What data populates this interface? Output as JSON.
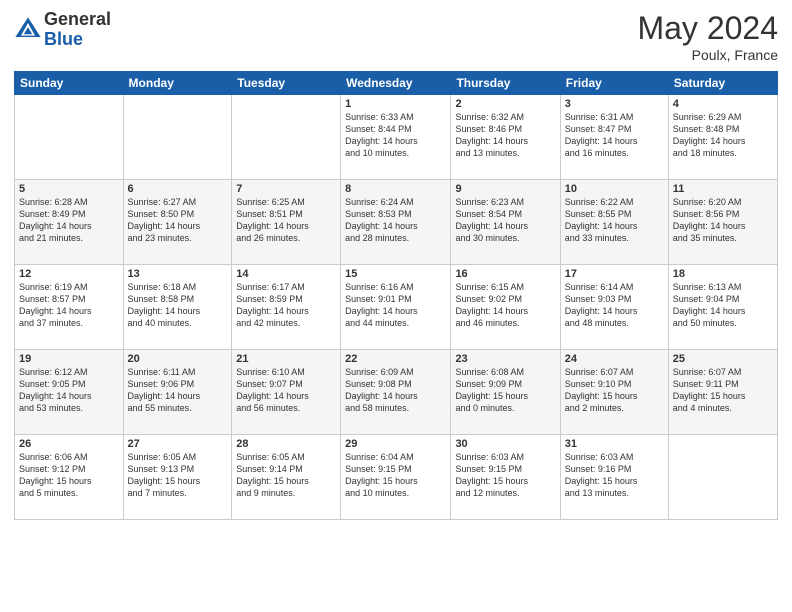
{
  "logo": {
    "general": "General",
    "blue": "Blue"
  },
  "title": {
    "month_year": "May 2024",
    "location": "Poulx, France"
  },
  "calendar": {
    "headers": [
      "Sunday",
      "Monday",
      "Tuesday",
      "Wednesday",
      "Thursday",
      "Friday",
      "Saturday"
    ],
    "weeks": [
      [
        {
          "day": "",
          "content": ""
        },
        {
          "day": "",
          "content": ""
        },
        {
          "day": "",
          "content": ""
        },
        {
          "day": "1",
          "content": "Sunrise: 6:33 AM\nSunset: 8:44 PM\nDaylight: 14 hours\nand 10 minutes."
        },
        {
          "day": "2",
          "content": "Sunrise: 6:32 AM\nSunset: 8:46 PM\nDaylight: 14 hours\nand 13 minutes."
        },
        {
          "day": "3",
          "content": "Sunrise: 6:31 AM\nSunset: 8:47 PM\nDaylight: 14 hours\nand 16 minutes."
        },
        {
          "day": "4",
          "content": "Sunrise: 6:29 AM\nSunset: 8:48 PM\nDaylight: 14 hours\nand 18 minutes."
        }
      ],
      [
        {
          "day": "5",
          "content": "Sunrise: 6:28 AM\nSunset: 8:49 PM\nDaylight: 14 hours\nand 21 minutes."
        },
        {
          "day": "6",
          "content": "Sunrise: 6:27 AM\nSunset: 8:50 PM\nDaylight: 14 hours\nand 23 minutes."
        },
        {
          "day": "7",
          "content": "Sunrise: 6:25 AM\nSunset: 8:51 PM\nDaylight: 14 hours\nand 26 minutes."
        },
        {
          "day": "8",
          "content": "Sunrise: 6:24 AM\nSunset: 8:53 PM\nDaylight: 14 hours\nand 28 minutes."
        },
        {
          "day": "9",
          "content": "Sunrise: 6:23 AM\nSunset: 8:54 PM\nDaylight: 14 hours\nand 30 minutes."
        },
        {
          "day": "10",
          "content": "Sunrise: 6:22 AM\nSunset: 8:55 PM\nDaylight: 14 hours\nand 33 minutes."
        },
        {
          "day": "11",
          "content": "Sunrise: 6:20 AM\nSunset: 8:56 PM\nDaylight: 14 hours\nand 35 minutes."
        }
      ],
      [
        {
          "day": "12",
          "content": "Sunrise: 6:19 AM\nSunset: 8:57 PM\nDaylight: 14 hours\nand 37 minutes."
        },
        {
          "day": "13",
          "content": "Sunrise: 6:18 AM\nSunset: 8:58 PM\nDaylight: 14 hours\nand 40 minutes."
        },
        {
          "day": "14",
          "content": "Sunrise: 6:17 AM\nSunset: 8:59 PM\nDaylight: 14 hours\nand 42 minutes."
        },
        {
          "day": "15",
          "content": "Sunrise: 6:16 AM\nSunset: 9:01 PM\nDaylight: 14 hours\nand 44 minutes."
        },
        {
          "day": "16",
          "content": "Sunrise: 6:15 AM\nSunset: 9:02 PM\nDaylight: 14 hours\nand 46 minutes."
        },
        {
          "day": "17",
          "content": "Sunrise: 6:14 AM\nSunset: 9:03 PM\nDaylight: 14 hours\nand 48 minutes."
        },
        {
          "day": "18",
          "content": "Sunrise: 6:13 AM\nSunset: 9:04 PM\nDaylight: 14 hours\nand 50 minutes."
        }
      ],
      [
        {
          "day": "19",
          "content": "Sunrise: 6:12 AM\nSunset: 9:05 PM\nDaylight: 14 hours\nand 53 minutes."
        },
        {
          "day": "20",
          "content": "Sunrise: 6:11 AM\nSunset: 9:06 PM\nDaylight: 14 hours\nand 55 minutes."
        },
        {
          "day": "21",
          "content": "Sunrise: 6:10 AM\nSunset: 9:07 PM\nDaylight: 14 hours\nand 56 minutes."
        },
        {
          "day": "22",
          "content": "Sunrise: 6:09 AM\nSunset: 9:08 PM\nDaylight: 14 hours\nand 58 minutes."
        },
        {
          "day": "23",
          "content": "Sunrise: 6:08 AM\nSunset: 9:09 PM\nDaylight: 15 hours\nand 0 minutes."
        },
        {
          "day": "24",
          "content": "Sunrise: 6:07 AM\nSunset: 9:10 PM\nDaylight: 15 hours\nand 2 minutes."
        },
        {
          "day": "25",
          "content": "Sunrise: 6:07 AM\nSunset: 9:11 PM\nDaylight: 15 hours\nand 4 minutes."
        }
      ],
      [
        {
          "day": "26",
          "content": "Sunrise: 6:06 AM\nSunset: 9:12 PM\nDaylight: 15 hours\nand 5 minutes."
        },
        {
          "day": "27",
          "content": "Sunrise: 6:05 AM\nSunset: 9:13 PM\nDaylight: 15 hours\nand 7 minutes."
        },
        {
          "day": "28",
          "content": "Sunrise: 6:05 AM\nSunset: 9:14 PM\nDaylight: 15 hours\nand 9 minutes."
        },
        {
          "day": "29",
          "content": "Sunrise: 6:04 AM\nSunset: 9:15 PM\nDaylight: 15 hours\nand 10 minutes."
        },
        {
          "day": "30",
          "content": "Sunrise: 6:03 AM\nSunset: 9:15 PM\nDaylight: 15 hours\nand 12 minutes."
        },
        {
          "day": "31",
          "content": "Sunrise: 6:03 AM\nSunset: 9:16 PM\nDaylight: 15 hours\nand 13 minutes."
        },
        {
          "day": "",
          "content": ""
        }
      ]
    ]
  }
}
